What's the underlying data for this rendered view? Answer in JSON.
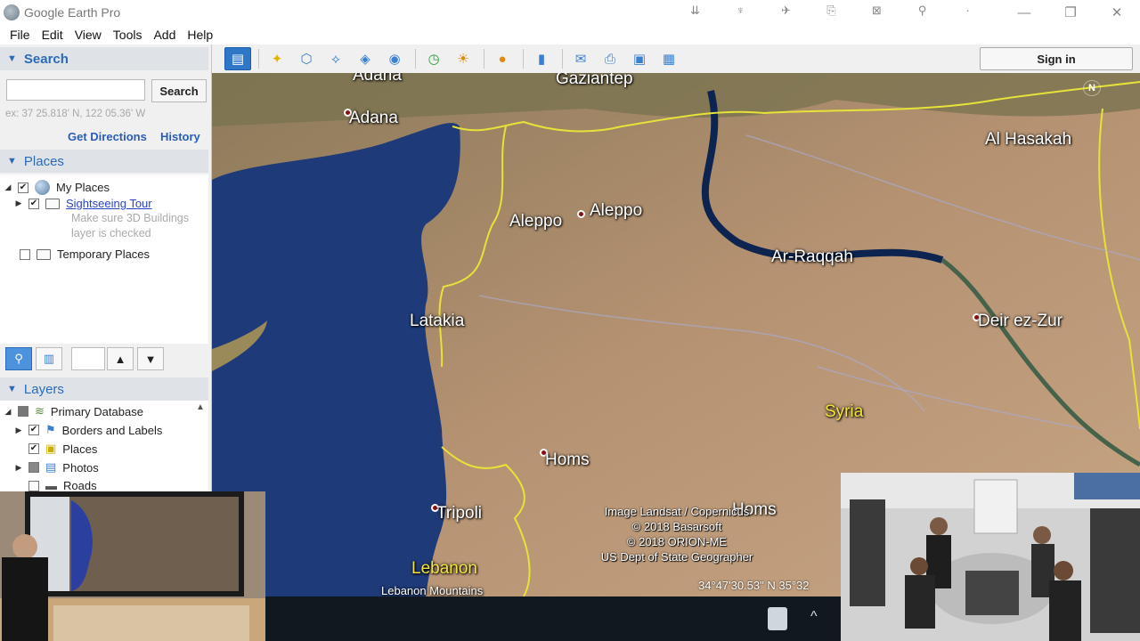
{
  "window": {
    "title": "Google Earth Pro",
    "title_tool_icons": [
      "toolbar-toggle-icon",
      "placemark-pin-icon",
      "plane-icon",
      "export-icon",
      "web-icon",
      "pin-pushpin-icon",
      "dot-icon"
    ],
    "controls": {
      "minimize": "—",
      "maximize": "❐",
      "close": "✕"
    }
  },
  "menu": [
    "File",
    "Edit",
    "View",
    "Tools",
    "Add",
    "Help"
  ],
  "toolbar": {
    "sign_in_label": "Sign in",
    "buttons": [
      "sidebar",
      "placemark",
      "polygon",
      "path",
      "overlay",
      "record-tour",
      "historical-imagery",
      "sunlight",
      "switch-planet",
      "ruler",
      "email",
      "print",
      "save-image",
      "view-in-maps"
    ]
  },
  "search": {
    "header": "Search",
    "input_value": "",
    "button_label": "Search",
    "hint": "ex: 37 25.818' N, 122 05.36' W",
    "get_directions": "Get Directions",
    "history": "History"
  },
  "places": {
    "header": "Places",
    "my_places": "My Places",
    "sightseeing_tour": "Sightseeing Tour",
    "note_line1": "Make sure 3D Buildings",
    "note_line2": "layer is checked",
    "temporary_places": "Temporary Places"
  },
  "layers": {
    "header": "Layers",
    "items": [
      "Primary Database",
      "Borders and Labels",
      "Places",
      "Photos",
      "Roads"
    ]
  },
  "map": {
    "labels": {
      "adana_top": "Adana",
      "adana": "Adana",
      "gaziantep": "Gaziantep",
      "al_hasakah": "Al Hasakah",
      "aleppo_en": "Aleppo",
      "aleppo_city": "Aleppo",
      "ar_raqqah": "Ar-Raqqah",
      "deir_ez_zur": "Deir ez-Zur",
      "latakia": "Latakia",
      "syria": "Syria",
      "homs": "Homs",
      "homs_overlap": "Homs",
      "tripoli": "Tripoli",
      "lebanon": "Lebanon",
      "lebanon_mountains": "Lebanon Mountains"
    },
    "attribution": [
      "Image Landsat / Copernicus",
      "© 2018 Basarsoft",
      "© 2018 ORION-ME",
      "US Dept of State Geographer"
    ],
    "coordinates": "34°47'30.53\" N   35°32",
    "north": "N",
    "colors": {
      "sea": "#1f3a78",
      "land": "#b39173",
      "border": "#e6e23a",
      "river": "#0e2450"
    }
  },
  "taskbar": {
    "tray_icons": [
      "recycle-bin-icon",
      "tray-caret-icon"
    ]
  }
}
